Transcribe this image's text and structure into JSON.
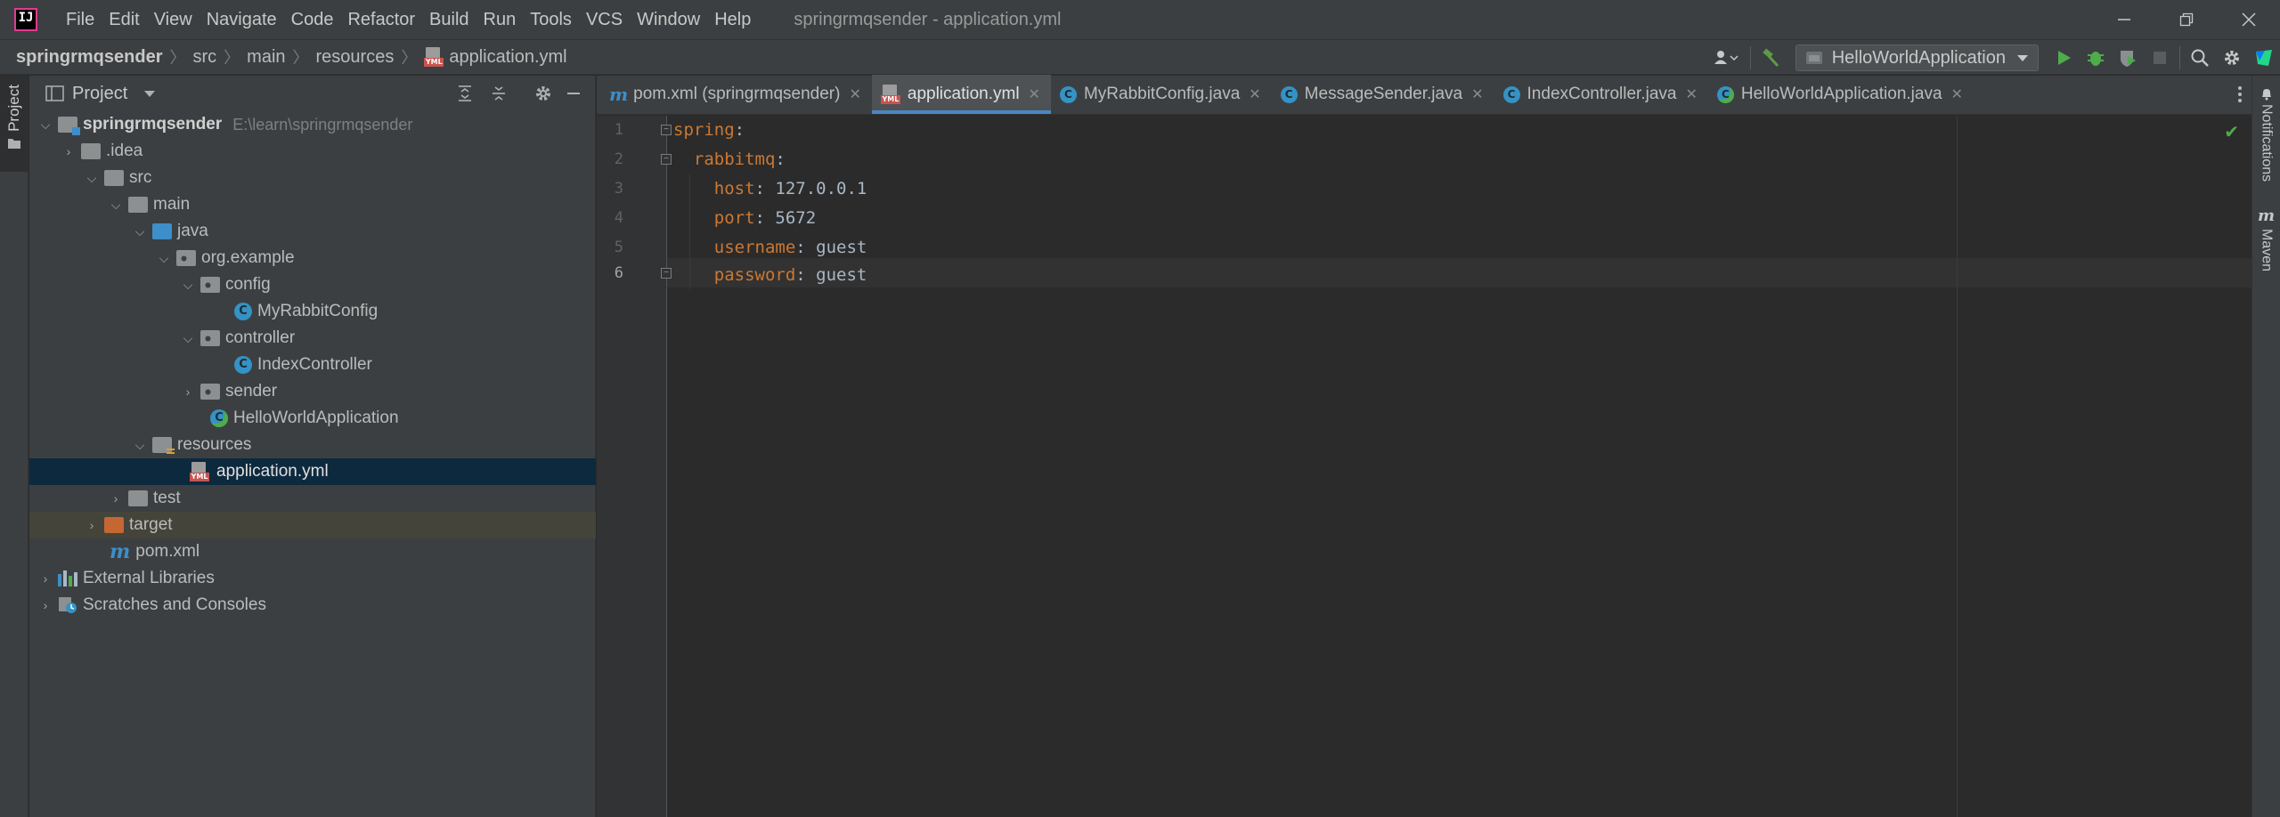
{
  "app": {
    "logo_text": "IJ",
    "window_title": "springrmqsender - application.yml"
  },
  "menu": [
    "File",
    "Edit",
    "View",
    "Navigate",
    "Code",
    "Refactor",
    "Build",
    "Run",
    "Tools",
    "VCS",
    "Window",
    "Help"
  ],
  "breadcrumb": [
    "springrmqsender",
    "src",
    "main",
    "resources",
    "application.yml"
  ],
  "toolbar": {
    "run_config": "HelloWorldApplication"
  },
  "stripes": {
    "left": "Project",
    "right": [
      "Notifications",
      "Maven"
    ]
  },
  "project": {
    "title": "Project",
    "root_path": "E:\\learn\\springrmqsender",
    "tree": [
      {
        "label": "springrmqsender"
      },
      {
        "label": ".idea"
      },
      {
        "label": "src"
      },
      {
        "label": "main"
      },
      {
        "label": "java"
      },
      {
        "label": "org.example"
      },
      {
        "label": "config"
      },
      {
        "label": "MyRabbitConfig"
      },
      {
        "label": "controller"
      },
      {
        "label": "IndexController"
      },
      {
        "label": "sender"
      },
      {
        "label": "HelloWorldApplication"
      },
      {
        "label": "resources"
      },
      {
        "label": "application.yml"
      },
      {
        "label": "test"
      },
      {
        "label": "target"
      },
      {
        "label": "pom.xml"
      },
      {
        "label": "External Libraries"
      },
      {
        "label": "Scratches and Consoles"
      }
    ]
  },
  "tabs": [
    {
      "label": "pom.xml (springrmqsender)",
      "icon": "maven-icon"
    },
    {
      "label": "application.yml",
      "icon": "yaml-file-icon",
      "active": true
    },
    {
      "label": "MyRabbitConfig.java",
      "icon": "class-icon"
    },
    {
      "label": "MessageSender.java",
      "icon": "class-icon"
    },
    {
      "label": "IndexController.java",
      "icon": "class-icon"
    },
    {
      "label": "HelloWorldApplication.java",
      "icon": "spring-class-icon"
    }
  ],
  "editor": {
    "line_numbers": [
      "1",
      "2",
      "3",
      "4",
      "5",
      "6"
    ],
    "lines": [
      {
        "key": "spring",
        "sep": ":",
        "value": ""
      },
      {
        "key": "rabbitmq",
        "sep": ":",
        "value": ""
      },
      {
        "key": "host",
        "sep": ": ",
        "value": "127.0.0.1"
      },
      {
        "key": "port",
        "sep": ": ",
        "value": "5672"
      },
      {
        "key": "username",
        "sep": ": ",
        "value": "guest"
      },
      {
        "key": "password",
        "sep": ": ",
        "value": "guest"
      }
    ],
    "current_line": 6
  },
  "colors": {
    "accent": "#4a88c7",
    "yaml_key": "#cc7832",
    "run_green": "#4eac4b"
  }
}
